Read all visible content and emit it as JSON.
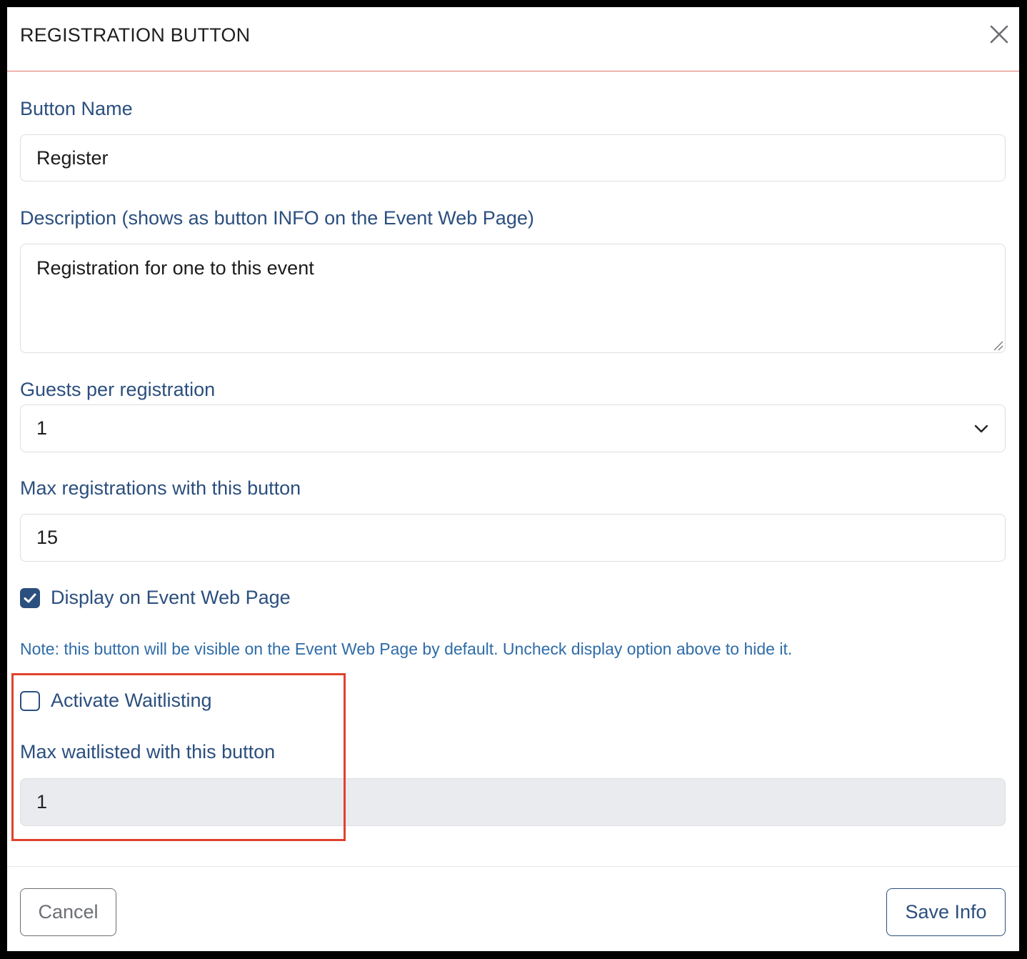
{
  "dialog": {
    "title": "REGISTRATION BUTTON",
    "close_icon": "close-icon"
  },
  "form": {
    "button_name": {
      "label": "Button Name",
      "value": "Register"
    },
    "description": {
      "label": "Description (shows as button INFO on the Event Web Page)",
      "value": "Registration for one to this event"
    },
    "guests_per_registration": {
      "label": "Guests per registration",
      "selected": "1",
      "icon": "chevron-down-icon"
    },
    "max_registrations": {
      "label": "Max registrations with this button",
      "value": "15"
    },
    "display_on_page": {
      "label": "Display on Event Web Page",
      "checked": true
    },
    "note": "Note: this button will be visible on the Event Web Page by default. Uncheck display option above to hide it.",
    "activate_waitlisting": {
      "label": "Activate Waitlisting",
      "checked": false
    },
    "max_waitlisted": {
      "label": "Max waitlisted with this button",
      "value": "1",
      "disabled": true
    }
  },
  "footer": {
    "cancel_label": "Cancel",
    "save_label": "Save Info"
  },
  "colors": {
    "label": "#2b4f7e",
    "note": "#2f6ca8",
    "highlight": "#e0412e",
    "header_divider": "#e0736b"
  }
}
